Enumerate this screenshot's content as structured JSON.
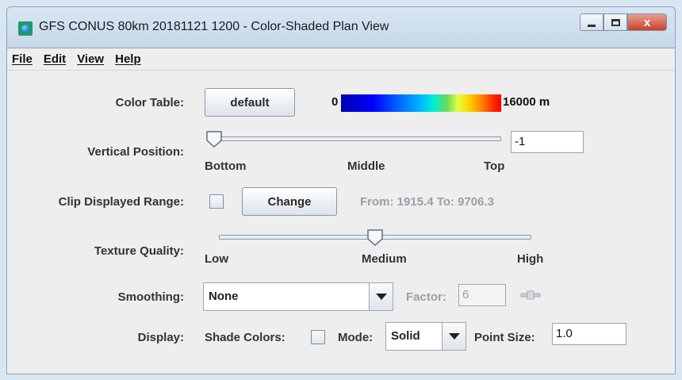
{
  "window": {
    "title": "GFS CONUS 80km 20181121 1200 - Color-Shaded Plan View",
    "minimize_icon": "minimize-icon",
    "maximize_icon": "maximize-icon",
    "close_label": "x"
  },
  "menu": [
    "File",
    "Edit",
    "View",
    "Help"
  ],
  "color_table": {
    "label": "Color Table:",
    "button": "default",
    "min_label": "0",
    "max_label": "16000 m"
  },
  "vertical_position": {
    "label": "Vertical Position:",
    "value": "-1",
    "ticks": [
      "Bottom",
      "Middle",
      "Top"
    ],
    "slider_level": 0.0
  },
  "clip_range": {
    "label": "Clip Displayed Range:",
    "checked": false,
    "button": "Change",
    "range_text": "From: 1915.4 To: 9706.3"
  },
  "texture_quality": {
    "label": "Texture Quality:",
    "ticks": [
      "Low",
      "Medium",
      "High"
    ],
    "slider_level": 0.5
  },
  "smoothing": {
    "label": "Smoothing:",
    "value": "None",
    "factor_label": "Factor:",
    "factor_value": "6"
  },
  "display": {
    "label": "Display:",
    "shade_colors_label": "Shade Colors:",
    "shade_colors_checked": false,
    "mode_label": "Mode:",
    "mode_value": "Solid",
    "point_size_label": "Point Size:",
    "point_size_value": "1.0"
  },
  "colors": {
    "title_bar": "#c7d8ea",
    "client_bg": "#eeeeee",
    "close_button": "#c7412a"
  }
}
